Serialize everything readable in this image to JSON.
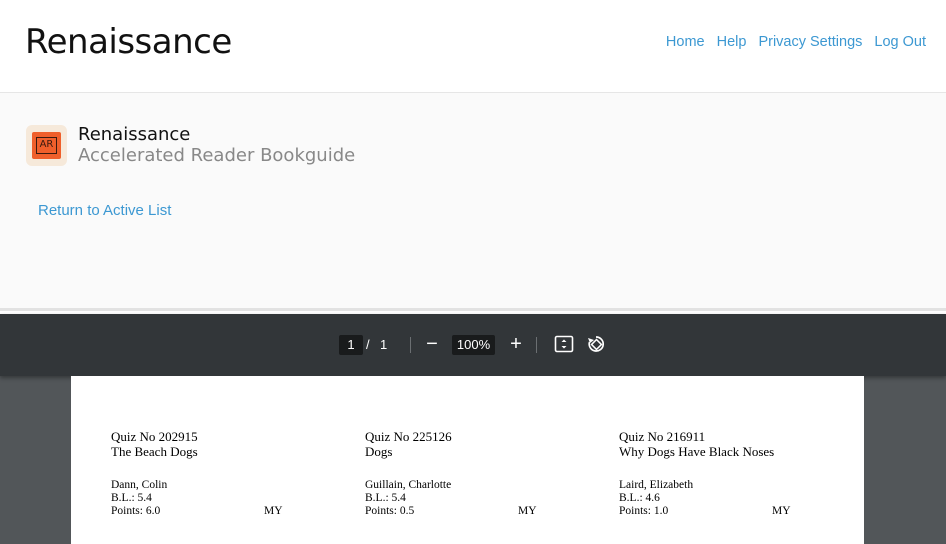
{
  "header": {
    "brand": "Renaissance",
    "nav": [
      "Home",
      "Help",
      "Privacy Settings",
      "Log Out"
    ]
  },
  "app": {
    "logo_text": "AR",
    "brand_small": "Renaissance",
    "product": "Accelerated Reader Bookguide",
    "return_link": "Return to Active List"
  },
  "pdf_toolbar": {
    "page_current": "1",
    "page_sep": "/",
    "page_total": "1",
    "zoom_out": "−",
    "zoom": "100%",
    "zoom_in": "+",
    "icons": [
      "fit-page-icon",
      "rotate-icon"
    ]
  },
  "books": [
    {
      "quiz_no": "Quiz No 202915",
      "title": "The Beach Dogs",
      "author": "Dann, Colin",
      "bl": "B.L.: 5.4",
      "points": "Points: 6.0",
      "level": "MY"
    },
    {
      "quiz_no": "Quiz No 225126",
      "title": "Dogs",
      "author": "Guillain, Charlotte",
      "bl": "B.L.: 5.4",
      "points": "Points: 0.5",
      "level": "MY"
    },
    {
      "quiz_no": "Quiz No 216911",
      "title": "Why Dogs Have Black Noses",
      "author": "Laird, Elizabeth",
      "bl": "B.L.: 4.6",
      "points": "Points: 1.0",
      "level": "MY"
    }
  ],
  "colors": {
    "link": "#3c98d2",
    "toolbar": "#323639",
    "viewer_bg": "#525659",
    "ar_orange": "#ef5f2b"
  }
}
